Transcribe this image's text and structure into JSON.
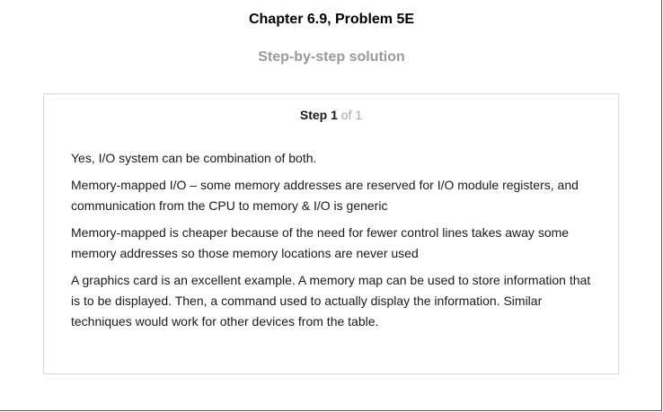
{
  "header": {
    "chapter_title": "Chapter 6.9, Problem 5E",
    "subtitle": "Step-by-step solution"
  },
  "step": {
    "label": "Step",
    "number": "1",
    "of_text": "of 1"
  },
  "solution": {
    "paragraphs": [
      "Yes, I/O system can be combination of both.",
      "Memory-mapped I/O – some memory addresses are reserved for I/O module registers, and communication from the CPU to memory & I/O is generic",
      "Memory-mapped is cheaper because of the need for fewer control lines takes away some memory addresses so those memory locations are never used",
      "A graphics card is an excellent example. A memory map can be used to store information that is to be displayed. Then, a command used to actually display the information. Similar techniques would work for other devices from the table."
    ]
  }
}
